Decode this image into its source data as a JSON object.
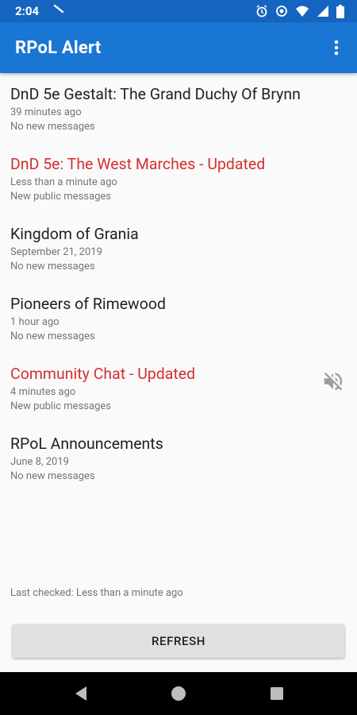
{
  "status_bar": {
    "time": "2:04",
    "icons": [
      "notification-icon",
      "alarm-icon",
      "data-saver-icon",
      "wifi-icon",
      "signal-icon",
      "battery-icon"
    ]
  },
  "app_bar": {
    "title": "RPoL Alert",
    "menu_icon": "overflow-menu-icon",
    "color": "#1976d2"
  },
  "games": [
    {
      "title": "DnD 5e Gestalt: The Grand Duchy Of Brynn",
      "time": "39 minutes ago",
      "status": "No new messages",
      "updated": false
    },
    {
      "title": "DnD 5e: The West Marches - Updated",
      "time": "Less than a minute ago",
      "status": "New public messages",
      "updated": true
    },
    {
      "title": "Kingdom of Grania",
      "time": "September 21, 2019",
      "status": "No new messages",
      "updated": false
    },
    {
      "title": "Pioneers of Rimewood",
      "time": "1 hour ago",
      "status": "No new messages",
      "updated": false
    },
    {
      "title": "Community Chat - Updated",
      "time": "4 minutes ago",
      "status": "New public messages",
      "updated": true,
      "muted": true
    },
    {
      "title": "RPoL Announcements",
      "time": "June 8, 2019",
      "status": "No new messages",
      "updated": false
    }
  ],
  "footer": {
    "last_checked": "Last checked: Less than a minute ago",
    "refresh_label": "REFRESH"
  },
  "nav_bar": {
    "icons": [
      "back-icon",
      "home-icon",
      "recents-icon"
    ]
  },
  "colors": {
    "updated_text": "#d32f2f",
    "status_bar": "#1565c0"
  }
}
